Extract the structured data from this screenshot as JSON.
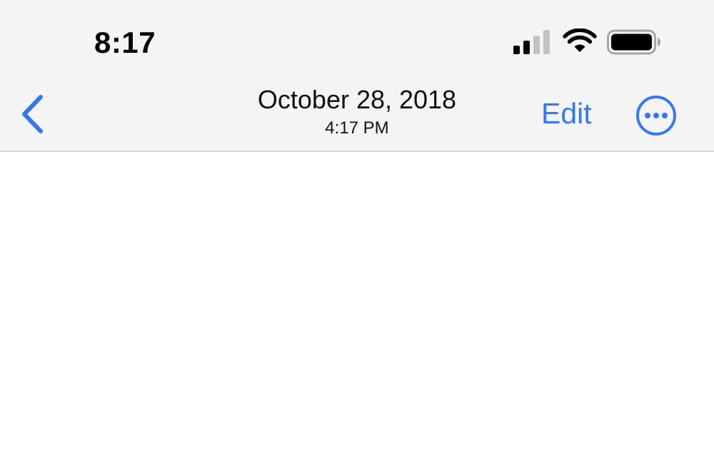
{
  "status_bar": {
    "time": "8:17",
    "signal_icon": "cellular-signal-icon",
    "wifi_icon": "wifi-icon",
    "battery_icon": "battery-icon"
  },
  "nav_bar": {
    "back_icon": "chevron-left-icon",
    "title": "October 28, 2018",
    "subtitle": "4:17 PM",
    "edit_label": "Edit",
    "more_icon": "ellipsis-circle-icon"
  },
  "colors": {
    "accent": "#3478f6",
    "chrome_background": "#f4f4f4",
    "separator": "#d4d4d4",
    "content_background": "#ffffff",
    "text": "#111111"
  }
}
